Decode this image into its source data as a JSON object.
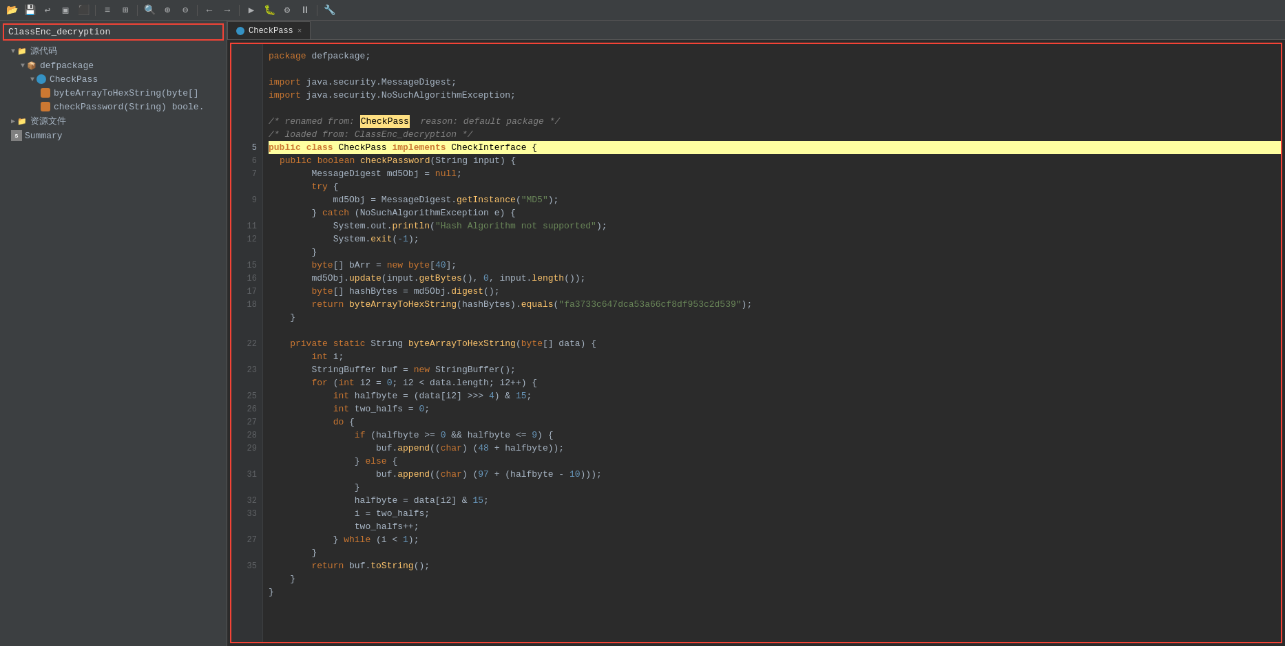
{
  "toolbar": {
    "buttons": [
      {
        "name": "open-icon",
        "symbol": "📂"
      },
      {
        "name": "save-icon",
        "symbol": "💾"
      },
      {
        "name": "undo-icon",
        "symbol": "↩"
      },
      {
        "name": "save2-icon",
        "symbol": "▣"
      },
      {
        "name": "export-icon",
        "symbol": "⬛"
      },
      {
        "name": "build-icon",
        "symbol": "≡"
      },
      {
        "name": "grid-icon",
        "symbol": "⊞"
      },
      {
        "name": "search-icon",
        "symbol": "🔍"
      },
      {
        "name": "zoom-in-icon",
        "symbol": "🔎"
      },
      {
        "name": "zoom-out-icon",
        "symbol": "🔍"
      },
      {
        "name": "back-icon",
        "symbol": "←"
      },
      {
        "name": "forward-icon",
        "symbol": "→"
      },
      {
        "name": "run-icon",
        "symbol": "▶"
      },
      {
        "name": "debug-icon",
        "symbol": "🐛"
      },
      {
        "name": "settings-icon",
        "symbol": "⚙"
      },
      {
        "name": "pause-icon",
        "symbol": "⏸"
      },
      {
        "name": "wrench-icon",
        "symbol": "🔧"
      }
    ]
  },
  "sidebar": {
    "project_name": "ClassEnc_decryption",
    "tree": [
      {
        "id": "source-root",
        "label": "源代码",
        "level": 0,
        "has_arrow": true,
        "icon": "folder"
      },
      {
        "id": "defpackage",
        "label": "defpackage",
        "level": 1,
        "has_arrow": true,
        "icon": "folder"
      },
      {
        "id": "checkpass-class",
        "label": "CheckPass",
        "level": 2,
        "has_arrow": true,
        "icon": "class"
      },
      {
        "id": "method1",
        "label": "byteArrayToHexString(byte[]",
        "level": 3,
        "has_arrow": false,
        "icon": "method"
      },
      {
        "id": "method2",
        "label": "checkPassword(String) boole.",
        "level": 3,
        "has_arrow": false,
        "icon": "method"
      },
      {
        "id": "resource-root",
        "label": "资源文件",
        "level": 0,
        "has_arrow": true,
        "icon": "folder"
      },
      {
        "id": "summary",
        "label": "Summary",
        "level": 0,
        "has_arrow": false,
        "icon": "summary"
      }
    ]
  },
  "tab": {
    "label": "CheckPass",
    "close": "×"
  },
  "code": {
    "lines": [
      {
        "num": "",
        "content": "package defpackage;"
      },
      {
        "num": "",
        "content": ""
      },
      {
        "num": "",
        "content": "import java.security.MessageDigest;"
      },
      {
        "num": "",
        "content": "import java.security.NoSuchAlgorithmException;"
      },
      {
        "num": "",
        "content": ""
      },
      {
        "num": "",
        "content": "/* renamed from: CheckPass  reason: default package */"
      },
      {
        "num": "",
        "content": "/* loaded from: ClassEnc_decryption */"
      },
      {
        "num": "5",
        "content": "public class CheckPass implements CheckInterface {",
        "highlight": true
      },
      {
        "num": "6",
        "content": "    public boolean checkPassword(String input) {"
      },
      {
        "num": "7",
        "content": "        MessageDigest md5Obj = null;"
      },
      {
        "num": "",
        "content": "        try {"
      },
      {
        "num": "9",
        "content": "            md5Obj = MessageDigest.getInstance(\"MD5\");"
      },
      {
        "num": "",
        "content": "        } catch (NoSuchAlgorithmException e) {"
      },
      {
        "num": "11",
        "content": "            System.out.println(\"Hash Algorithm not supported\");"
      },
      {
        "num": "12",
        "content": "            System.exit(-1);"
      },
      {
        "num": "",
        "content": "        }"
      },
      {
        "num": "15",
        "content": "        byte[] bArr = new byte[40];"
      },
      {
        "num": "16",
        "content": "        md5Obj.update(input.getBytes(), 0, input.length());"
      },
      {
        "num": "17",
        "content": "        byte[] hashBytes = md5Obj.digest();"
      },
      {
        "num": "18",
        "content": "        return byteArrayToHexString(hashBytes).equals(\"fa3733c647dca53a66cf8df953c2d539\");"
      },
      {
        "num": "",
        "content": "    }"
      },
      {
        "num": "",
        "content": ""
      },
      {
        "num": "22",
        "content": "    private static String byteArrayToHexString(byte[] data) {"
      },
      {
        "num": "",
        "content": "        int i;"
      },
      {
        "num": "23",
        "content": "        StringBuffer buf = new StringBuffer();"
      },
      {
        "num": "",
        "content": "        for (int i2 = 0; i2 < data.length; i2++) {"
      },
      {
        "num": "25",
        "content": "            int halfbyte = (data[i2] >>> 4) & 15;"
      },
      {
        "num": "26",
        "content": "            int two_halfs = 0;"
      },
      {
        "num": "27",
        "content": "            do {"
      },
      {
        "num": "28",
        "content": "                if (halfbyte >= 0 && halfbyte <= 9) {"
      },
      {
        "num": "29",
        "content": "                    buf.append((char) (48 + halfbyte));"
      },
      {
        "num": "",
        "content": "                } else {"
      },
      {
        "num": "31",
        "content": "                    buf.append((char) (97 + (halfbyte - 10)));"
      },
      {
        "num": "",
        "content": "                }"
      },
      {
        "num": "32",
        "content": "                halfbyte = data[i2] & 15;"
      },
      {
        "num": "33",
        "content": "                i = two_halfs;"
      },
      {
        "num": "",
        "content": "                two_halfs++;"
      },
      {
        "num": "27",
        "content": "            } while (i < 1);"
      },
      {
        "num": "",
        "content": "        }"
      },
      {
        "num": "35",
        "content": "        return buf.toString();"
      },
      {
        "num": "",
        "content": "    }"
      },
      {
        "num": "",
        "content": "}"
      }
    ]
  }
}
